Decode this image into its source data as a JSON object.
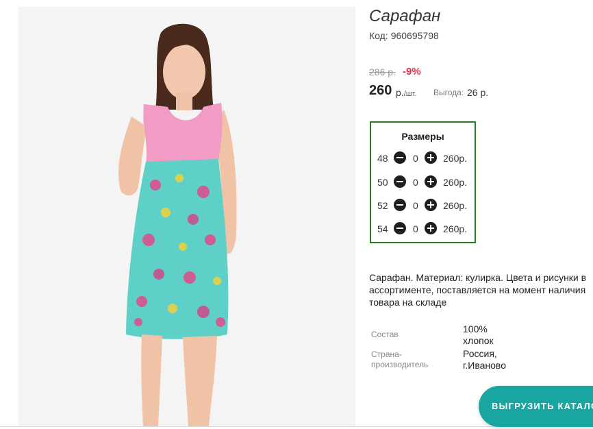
{
  "product": {
    "title": "Сарафан",
    "code_label": "Код:",
    "code": "960695798",
    "old_price": "286 р.",
    "discount": "-9%",
    "price": "260",
    "price_unit": "р.",
    "price_per": "/шт.",
    "benefit_label": "Выгода:",
    "benefit_value": "26 р."
  },
  "sizes": {
    "title": "Размеры",
    "items": [
      {
        "size": "48",
        "qty": "0",
        "price": "260р."
      },
      {
        "size": "50",
        "qty": "0",
        "price": "260р."
      },
      {
        "size": "52",
        "qty": "0",
        "price": "260р."
      },
      {
        "size": "54",
        "qty": "0",
        "price": "260р."
      }
    ]
  },
  "description": "Сарафан. Материал: кулирка. Цвета и рисунки в ассортименте, поставляется на момент наличия товара на складе",
  "specs": {
    "composition_label": "Состав",
    "composition_value_1": "100%",
    "composition_value_2": "хлопок",
    "country_label_1": "Страна-",
    "country_label_2": "производитель",
    "country_value_1": "Россия,",
    "country_value_2": "г.Иваново"
  },
  "export_button": "ВЫГРУЗИТЬ КАТАЛОГ",
  "colors": {
    "accent": "#1aa6a0",
    "sizes_border": "#1f7f1f",
    "discount": "#e0334b",
    "dress_top": "#f29bc4",
    "dress_print": "#5fd0c8"
  }
}
